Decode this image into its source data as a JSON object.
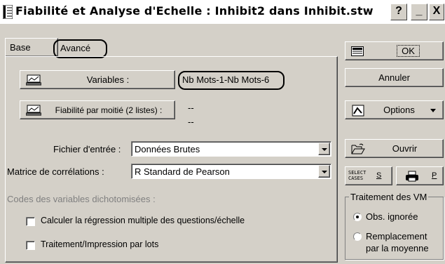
{
  "window": {
    "title": "Fiabilité et Analyse d'Echelle : Inhibit2 dans Inhibit.stw"
  },
  "titlebar_buttons": {
    "help": "?",
    "minimize": "_",
    "close": "X"
  },
  "tabs": [
    {
      "label": "Base"
    },
    {
      "label": "Avancé"
    }
  ],
  "main": {
    "variables_button": "Variables :",
    "variables_value": "Nb Mots-1-Nb Mots-6",
    "split_half_button": "Fiabilité par moitié (2 listes) :",
    "split_half_value1": "--",
    "split_half_value2": "--",
    "input_file_label": "Fichier d'entrée :",
    "input_file_value": "Données Brutes",
    "corr_matrix_label": "Matrice de corrélations :",
    "corr_matrix_value": "R Standard de Pearson",
    "dichotomous_label": "Codes des variables dichotomisées :",
    "check_regression": "Calculer la régression multiple des questions/échelle",
    "check_batch": "Traitement/Impression par lots"
  },
  "side": {
    "ok": "OK",
    "cancel": "Annuler",
    "options": "Options",
    "open": "Ouvrir",
    "select_cases": "SELECT CASES",
    "s_label": "S",
    "p_label": "P",
    "mv_group_title": "Traitement des VM",
    "mv_option1": "Obs. ignorée",
    "mv_option2_line1": "Remplacement",
    "mv_option2_line2": "par la moyenne"
  }
}
